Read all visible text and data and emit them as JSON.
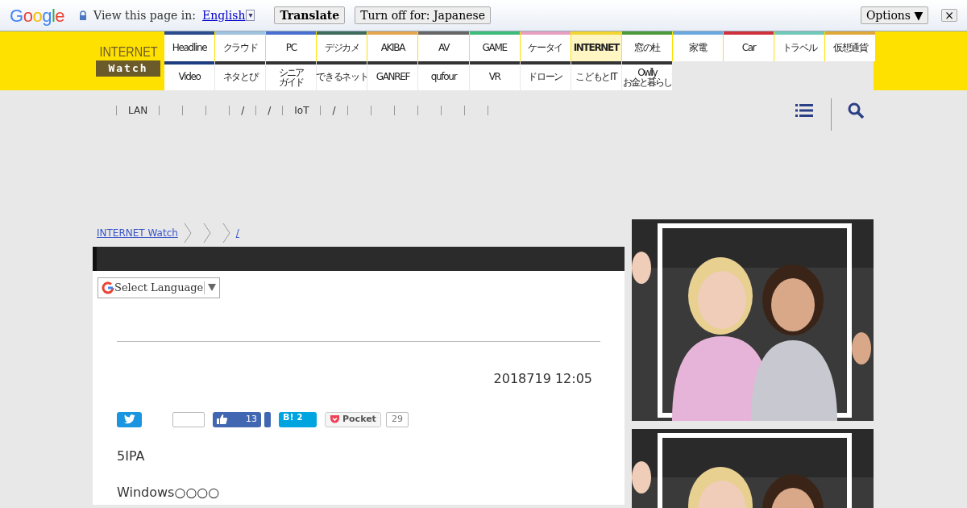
{
  "translate_bar": {
    "google_logo": "Google",
    "prompt": "View this page in:",
    "language": "English",
    "language_dropdown": "▾",
    "translate_button": "Translate",
    "turn_off_button": "Turn off for: Japanese",
    "options_button": "Options ▼",
    "close": "×"
  },
  "logo": {
    "line1": "INTERNET",
    "line2": "Watch"
  },
  "nav_rows": [
    [
      {
        "label": "Headline",
        "color": "#2b4c8c",
        "selected": false
      },
      {
        "label": "クラウド",
        "color": "#9fc3dc",
        "selected": false
      },
      {
        "label": "PC",
        "color": "#4a6fd0",
        "selected": false
      },
      {
        "label": "デジカメ",
        "color": "#3e6b5c",
        "selected": false
      },
      {
        "label": "AKIBA",
        "color": "#e3a550",
        "selected": false
      },
      {
        "label": "AV",
        "color": "#666666",
        "selected": false
      },
      {
        "label": "GAME",
        "color": "#3dbb7a",
        "selected": false
      },
      {
        "label": "ケータイ",
        "color": "#e8a0c0",
        "selected": false
      },
      {
        "label": "INTERNET",
        "color": "#f2d530",
        "selected": true
      },
      {
        "label": "窓の杜",
        "color": "#4c9a3a",
        "selected": false
      },
      {
        "label": "家電",
        "color": "#6aa8e0",
        "selected": false
      },
      {
        "label": "Car",
        "color": "#d0303c",
        "selected": false
      },
      {
        "label": "トラベル",
        "color": "#70c8b8",
        "selected": false
      },
      {
        "label": "仮想通貨",
        "color": "#e0a838",
        "selected": false
      }
    ],
    [
      {
        "label": "Video",
        "color": "#1e3c80",
        "selected": false
      },
      {
        "label": "ネタとぴ",
        "color": "#333333",
        "selected": false
      },
      {
        "lines": [
          "シニア",
          "ガイド"
        ],
        "color": "#333333",
        "selected": false
      },
      {
        "label": "できるネット",
        "color": "#333333",
        "selected": false
      },
      {
        "label": "GANREF",
        "color": "#333333",
        "selected": false
      },
      {
        "label": "qufour",
        "color": "#333333",
        "selected": false
      },
      {
        "label": "VR",
        "color": "#333333",
        "selected": false
      },
      {
        "label": "ドローン",
        "color": "#333333",
        "selected": false
      },
      {
        "label": "こどもとIT",
        "color": "#333333",
        "selected": false
      },
      {
        "lines": [
          "Owlly",
          "お金と暮らし"
        ],
        "color": "#333333",
        "selected": false
      }
    ]
  ],
  "subnav": [
    {
      "text": "LAN"
    },
    {
      "text": "/"
    },
    {
      "text": "/"
    },
    {
      "text": "IoT"
    },
    {
      "text": "/"
    }
  ],
  "breadcrumb": [
    {
      "text": "INTERNET Watch"
    },
    {
      "text": "/"
    }
  ],
  "language_select": {
    "label": "Select Language"
  },
  "date": "2018719 12:05",
  "share": {
    "facebook_count": "13",
    "hatena_label": "B!",
    "hatena_count": "2",
    "pocket_label": "Pocket",
    "pocket_count": "29"
  },
  "body": [
    "5IPA",
    "Windows○○○○"
  ]
}
